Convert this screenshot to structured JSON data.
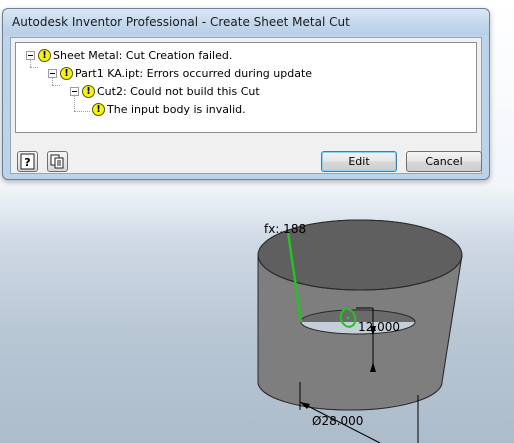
{
  "window": {
    "title": "Autodesk Inventor Professional - Create Sheet Metal Cut"
  },
  "tree": {
    "nodes": [
      {
        "label": "Sheet Metal: Cut Creation failed."
      },
      {
        "label": "Part1 KA.ipt: Errors occurred during update"
      },
      {
        "label": "Cut2: Could not build this Cut"
      },
      {
        "label": "The input body is invalid."
      }
    ],
    "warning_glyph": "!"
  },
  "buttons": {
    "help_icon": "help-icon",
    "copy_icon": "copy-icon",
    "edit_label": "Edit",
    "cancel_label": "Cancel"
  },
  "canvas": {
    "fx_label": "fx:.188",
    "height_dimension": "12.000",
    "diameter_dimension": "Ø28.000"
  },
  "colors": {
    "warning": "#f6f21a",
    "selection_edge": "#22c322"
  }
}
